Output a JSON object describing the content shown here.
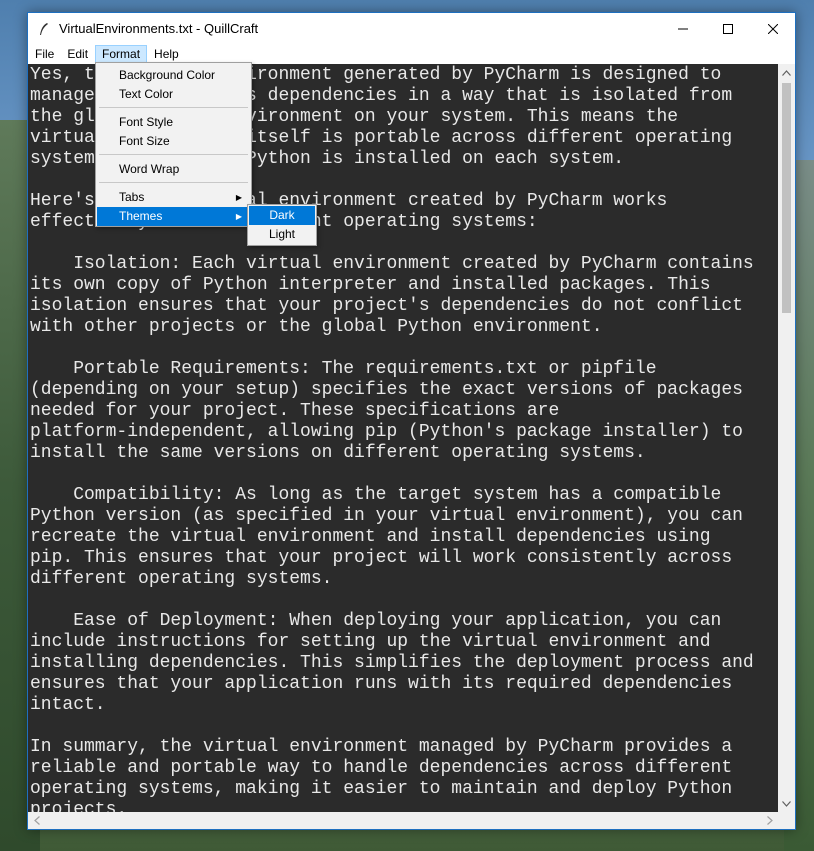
{
  "window": {
    "title": "VirtualEnvironments.txt - QuillCraft",
    "controls": [
      "minimize-icon",
      "maximize-icon",
      "close-icon"
    ]
  },
  "menubar": {
    "items": [
      "File",
      "Edit",
      "Format",
      "Help"
    ],
    "active": "Format"
  },
  "format_menu": {
    "items": [
      {
        "label": "Background Color"
      },
      {
        "label": "Text Color"
      },
      {
        "label": "Font Style"
      },
      {
        "label": "Font Size"
      },
      {
        "label": "Word Wrap"
      },
      {
        "label": "Tabs",
        "submenu": true
      },
      {
        "label": "Themes",
        "submenu": true,
        "highlighted": true
      }
    ]
  },
  "themes_submenu": {
    "items": [
      {
        "label": "Dark",
        "highlighted": true
      },
      {
        "label": "Light"
      }
    ]
  },
  "editor": {
    "background": "#2b2b2b",
    "text_color": "#e8e8e8",
    "lines": [
      "Yes, the virtual environment generated by PyCharm is designed to",
      "manage your project's dependencies in a way that is isolated from",
      "the global Python environment on your system. This means the",
      "virtual environment itself is portable across different operating",
      "systems, as long as Python is installed on each system.",
      "",
      "Here's how the virtual environment created by PyCharm works",
      "effectively across different operating systems:",
      "",
      "    Isolation: Each virtual environment created by PyCharm contains",
      "its own copy of Python interpreter and installed packages. This",
      "isolation ensures that your project's dependencies do not conflict",
      "with other projects or the global Python environment.",
      "",
      "    Portable Requirements: The requirements.txt or pipfile",
      "(depending on your setup) specifies the exact versions of packages",
      "needed for your project. These specifications are",
      "platform-independent, allowing pip (Python's package installer) to",
      "install the same versions on different operating systems.",
      "",
      "    Compatibility: As long as the target system has a compatible",
      "Python version (as specified in your virtual environment), you can",
      "recreate the virtual environment and install dependencies using",
      "pip. This ensures that your project will work consistently across",
      "different operating systems.",
      "",
      "    Ease of Deployment: When deploying your application, you can",
      "include instructions for setting up the virtual environment and",
      "installing dependencies. This simplifies the deployment process and",
      "ensures that your application runs with its required dependencies",
      "intact.",
      "",
      "In summary, the virtual environment managed by PyCharm provides a",
      "reliable and portable way to handle dependencies across different",
      "operating systems, making it easier to maintain and deploy Python",
      "projects."
    ]
  },
  "colors": {
    "accent": "#0078d7",
    "window_border": "#1e6fbf"
  }
}
